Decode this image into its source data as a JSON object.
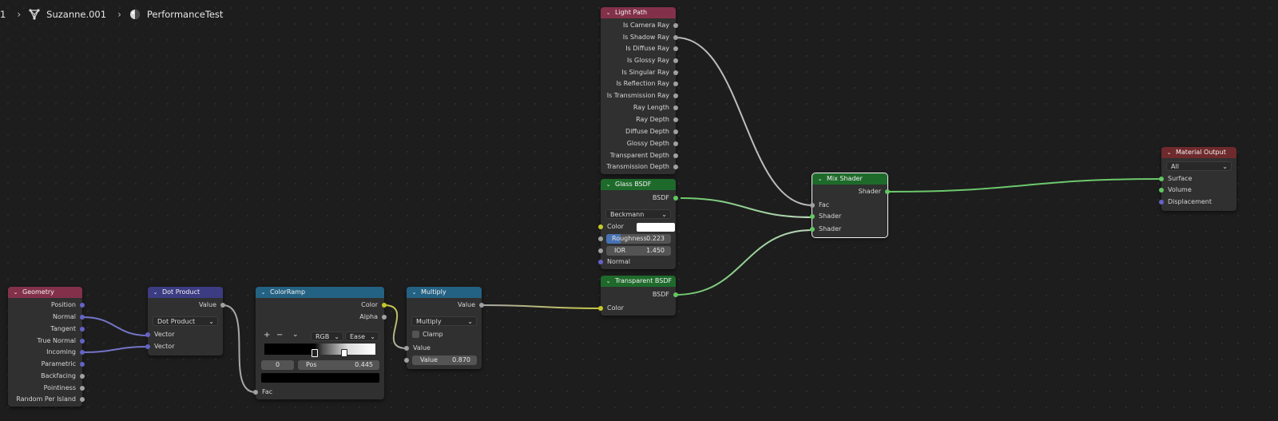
{
  "breadcrumb": {
    "first": "1",
    "object": "Suzanne.001",
    "material": "PerformanceTest"
  },
  "icons": {
    "chevron": "chevron-down-icon",
    "sep": "chevron-right-icon",
    "mesh": "mesh-data-icon",
    "material": "material-icon"
  },
  "colors": {
    "input_header": "#83314a",
    "vector_header": "#3c3c83",
    "converter_header": "#246283",
    "shader_header": "#1e6a2b",
    "output_header": "#6e2a2c"
  },
  "glyphs": {
    "chevron": "⌄",
    "sep": "›",
    "arrow": "⌄",
    "plus": "+",
    "minus": "−",
    "ramp_chev": "⌄"
  },
  "nodes": {
    "geometry": {
      "title": "Geometry",
      "outputs": [
        "Position",
        "Normal",
        "Tangent",
        "True Normal",
        "Incoming",
        "Parametric",
        "Backfacing",
        "Pointiness",
        "Random Per Island"
      ]
    },
    "dot_product": {
      "title": "Dot Product",
      "output": "Value",
      "operation": "Dot Product",
      "inputs": [
        "Vector",
        "Vector"
      ]
    },
    "color_ramp": {
      "title": "ColorRamp",
      "outputs": [
        "Color",
        "Alpha"
      ],
      "color_mode": "RGB",
      "interpolation": "Ease",
      "active_stop": "0",
      "pos_label": "Pos",
      "pos_value": "0.445",
      "input": "Fac"
    },
    "multiply": {
      "title": "Multiply",
      "output": "Value",
      "operation": "Multiply",
      "clamp_label": "Clamp",
      "clamp": false,
      "input_value": "Value",
      "value_label": "Value",
      "value": "0.870"
    },
    "light_path": {
      "title": "Light Path",
      "outputs": [
        "Is Camera Ray",
        "Is Shadow Ray",
        "Is Diffuse Ray",
        "Is Glossy Ray",
        "Is Singular Ray",
        "Is Reflection Ray",
        "Is Transmission Ray",
        "Ray Length",
        "Ray Depth",
        "Diffuse Depth",
        "Glossy Depth",
        "Transparent Depth",
        "Transmission Depth"
      ]
    },
    "glass_bsdf": {
      "title": "Glass BSDF",
      "output": "BSDF",
      "distribution": "Beckmann",
      "color_label": "Color",
      "color_value": "#ffffff",
      "roughness_label": "Roughness",
      "roughness": "0.223",
      "roughness_fraction": 0.223,
      "ior_label": "IOR",
      "ior": "1.450",
      "normal_label": "Normal"
    },
    "transparent_bsdf": {
      "title": "Transparent BSDF",
      "output": "BSDF",
      "color_label": "Color"
    },
    "mix_shader": {
      "title": "Mix Shader",
      "output": "Shader",
      "inputs": [
        "Fac",
        "Shader",
        "Shader"
      ]
    },
    "material_output": {
      "title": "Material Output",
      "target": "All",
      "inputs": [
        "Surface",
        "Volume",
        "Displacement"
      ]
    }
  }
}
